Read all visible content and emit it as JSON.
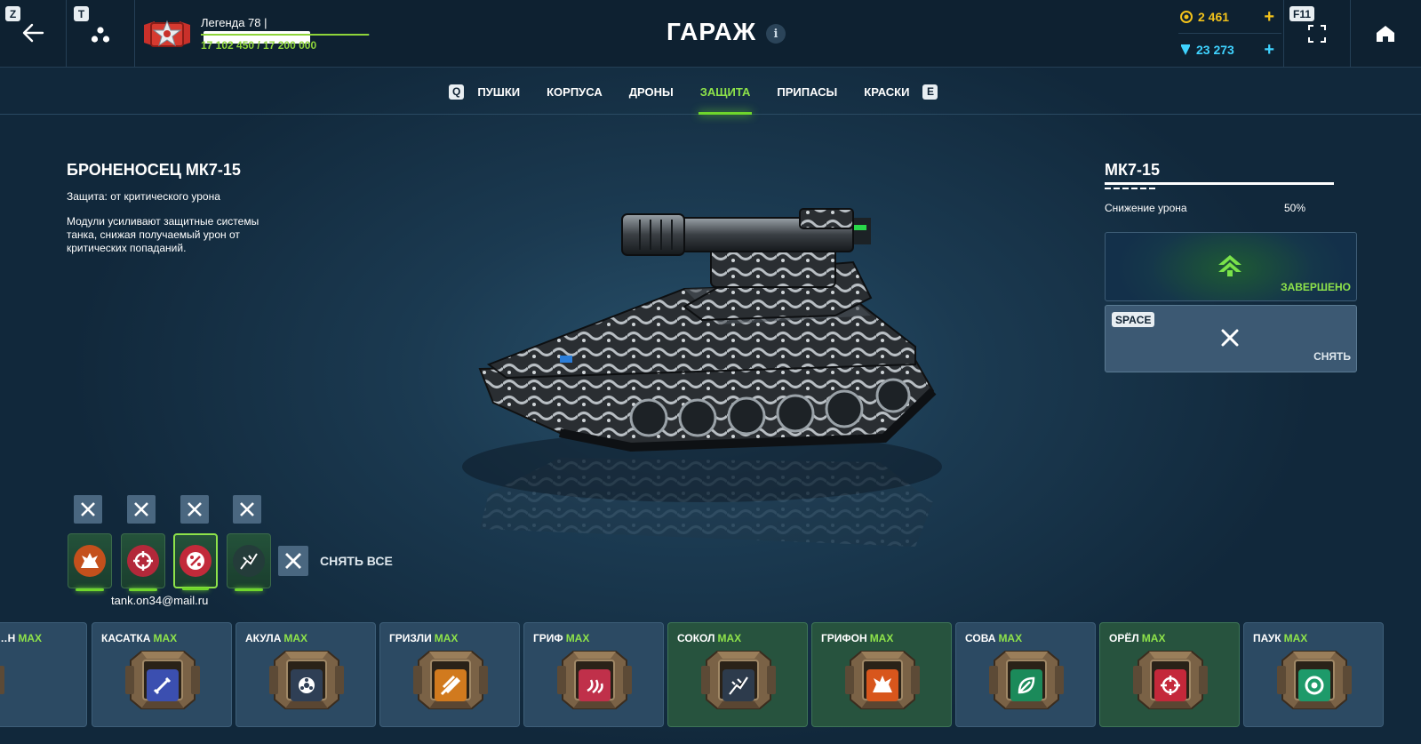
{
  "topbar": {
    "back_key": "Z",
    "friends_key": "T",
    "player_name": "Легенда 78 |",
    "experience": "17 102 450 / 17 200 000",
    "experience_fraction": 0.994,
    "title": "ГАРАЖ",
    "info_icon": "i",
    "coins": "2 461",
    "crystals": "23 273",
    "plus": "+",
    "fullscreen_key": "F11"
  },
  "tabs": {
    "prev_key": "Q",
    "next_key": "E",
    "items": [
      "ПУШКИ",
      "КОРПУСА",
      "ДРОНЫ",
      "ЗАЩИТА",
      "ПРИПАСЫ",
      "КРАСКИ"
    ],
    "active": "ЗАЩИТА"
  },
  "item": {
    "title": "БРОНЕНОСЕЦ МК7-15",
    "protection": "Защита: от критического урона",
    "description": "Модули усиливают защитные системы танка, снижая получаемый урон от критических попаданий."
  },
  "module_panel": {
    "name": "МК7-15",
    "stat_label": "Снижение урона",
    "stat_value": "50%",
    "upgrade_status": "ЗАВЕРШЕНО",
    "remove_key": "SPACE",
    "remove_label": "СНЯТЬ"
  },
  "slots": {
    "remove_all_label": "СНЯТЬ ВСЕ",
    "icons": [
      "explosion-icon",
      "crosshair-icon",
      "percent-icon",
      "shatter-icon"
    ]
  },
  "watermark": "tank.on34@mail.ru",
  "cards": [
    {
      "name": "…Н",
      "max": "MAX",
      "icon": "shard-icon",
      "color": "#5aa04a"
    },
    {
      "name": "КАСАТКА",
      "max": "MAX",
      "icon": "sword-icon",
      "color": "#3b4fb0"
    },
    {
      "name": "АКУЛА",
      "max": "MAX",
      "icon": "gear-icon",
      "color": "#2f3f55"
    },
    {
      "name": "ГРИЗЛИ",
      "max": "MAX",
      "icon": "rocket-icon",
      "color": "#d17a1e"
    },
    {
      "name": "ГРИФ",
      "max": "MAX",
      "icon": "fire-icon",
      "color": "#c0304a"
    },
    {
      "name": "СОКОЛ",
      "max": "MAX",
      "icon": "shatter-icon",
      "color": "#2d3b4c"
    },
    {
      "name": "ГРИФОН",
      "max": "MAX",
      "icon": "explosion-icon",
      "color": "#d8561c"
    },
    {
      "name": "СОВА",
      "max": "MAX",
      "icon": "leaf-icon",
      "color": "#1b8a5a"
    },
    {
      "name": "ОРЁЛ",
      "max": "MAX",
      "icon": "crosshair-icon",
      "color": "#c4283a"
    },
    {
      "name": "ПАУК",
      "max": "MAX",
      "icon": "target-icon",
      "color": "#1e9a6a"
    }
  ]
}
